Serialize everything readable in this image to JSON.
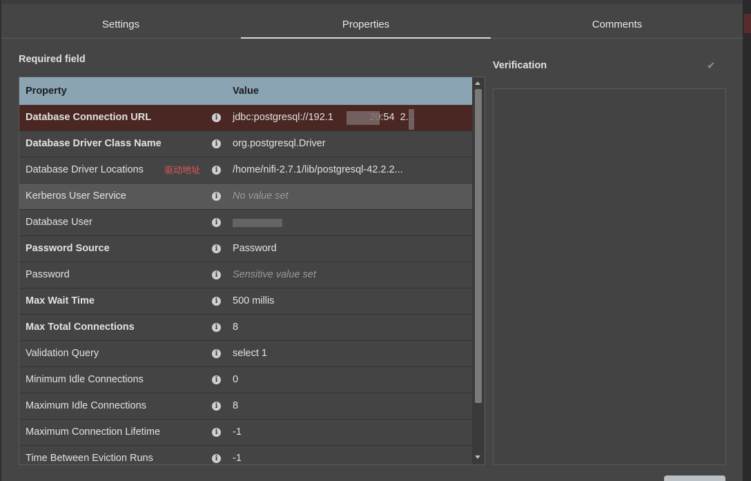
{
  "tabs": [
    {
      "label": "Settings"
    },
    {
      "label": "Properties"
    },
    {
      "label": "Comments"
    }
  ],
  "required_label": "Required field",
  "table": {
    "headers": {
      "property": "Property",
      "value": "Value"
    },
    "rows": [
      {
        "name": "Database Connection URL",
        "value": "jdbc:postgresql://192.1             20:54  2...",
        "note": ""
      },
      {
        "name": "Database Driver Class Name",
        "value": "org.postgresql.Driver",
        "note": ""
      },
      {
        "name": "Database Driver Locations",
        "value": "/home/nifi-2.7.1/lib/postgresql-42.2.2...",
        "note": "驱动地址"
      },
      {
        "name": "Kerberos User Service",
        "value": "No value set",
        "note": ""
      },
      {
        "name": "Database User",
        "value": "",
        "note": ""
      },
      {
        "name": "Password Source",
        "value": "Password",
        "note": ""
      },
      {
        "name": "Password",
        "value": "Sensitive value set",
        "note": ""
      },
      {
        "name": "Max Wait Time",
        "value": "500 millis",
        "note": ""
      },
      {
        "name": "Max Total Connections",
        "value": "8",
        "note": ""
      },
      {
        "name": "Validation Query",
        "value": "select 1",
        "note": ""
      },
      {
        "name": "Minimum Idle Connections",
        "value": "0",
        "note": ""
      },
      {
        "name": "Maximum Idle Connections",
        "value": "8",
        "note": ""
      },
      {
        "name": "Maximum Connection Lifetime",
        "value": "-1",
        "note": ""
      },
      {
        "name": "Time Between Eviction Runs",
        "value": "-1",
        "note": ""
      }
    ]
  },
  "verification": {
    "title": "Verification"
  },
  "icons": {
    "info": "info-icon",
    "check": "checkmark-icon"
  }
}
